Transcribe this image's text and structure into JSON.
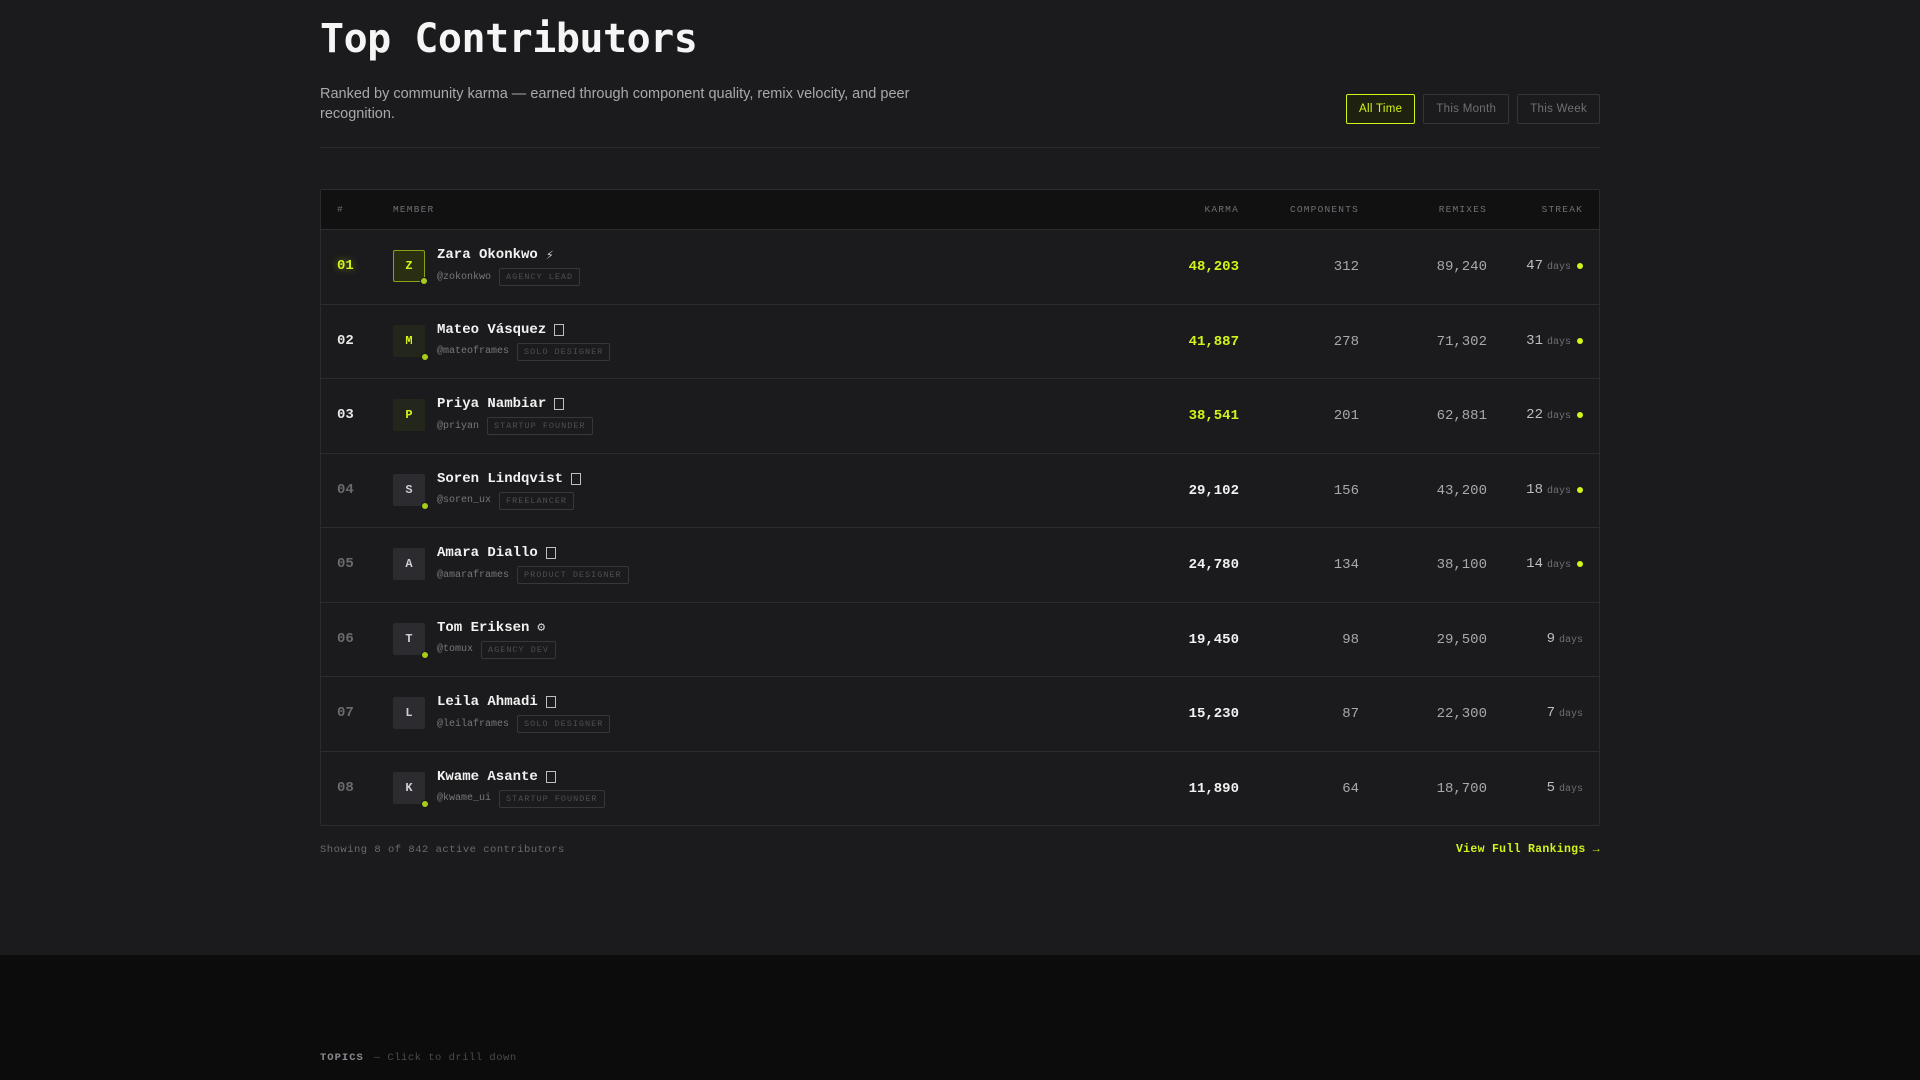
{
  "page": {
    "title": "Top Contributors",
    "subtitle": "Ranked by community karma — earned through component quality, remix velocity, and peer recognition."
  },
  "filters": [
    {
      "label": "All Time",
      "active": true
    },
    {
      "label": "This Month",
      "active": false
    },
    {
      "label": "This Week",
      "active": false
    }
  ],
  "table": {
    "headers": {
      "rank": "#",
      "member": "MEMBER",
      "karma": "KARMA",
      "components": "COMPONENTS",
      "remixes": "REMIXES",
      "streak": "STREAK"
    },
    "streak_unit": "days",
    "rows": [
      {
        "rank": "01",
        "initial": "Z",
        "name": "Zara Okonkwo",
        "badge": "⚡",
        "handle": "@zokonkwo",
        "role": "AGENCY LEAD",
        "karma": "48,203",
        "components": "312",
        "remixes": "89,240",
        "streak": "47",
        "online": true,
        "streak_active": true
      },
      {
        "rank": "02",
        "initial": "M",
        "name": "Mateo Vásquez",
        "badge": "box",
        "handle": "@mateoframes",
        "role": "SOLO DESIGNER",
        "karma": "41,887",
        "components": "278",
        "remixes": "71,302",
        "streak": "31",
        "online": true,
        "streak_active": true
      },
      {
        "rank": "03",
        "initial": "P",
        "name": "Priya Nambiar",
        "badge": "box",
        "handle": "@priyan",
        "role": "STARTUP FOUNDER",
        "karma": "38,541",
        "components": "201",
        "remixes": "62,881",
        "streak": "22",
        "online": false,
        "streak_active": true
      },
      {
        "rank": "04",
        "initial": "S",
        "name": "Soren Lindqvist",
        "badge": "box",
        "handle": "@soren_ux",
        "role": "FREELANCER",
        "karma": "29,102",
        "components": "156",
        "remixes": "43,200",
        "streak": "18",
        "online": true,
        "streak_active": true
      },
      {
        "rank": "05",
        "initial": "A",
        "name": "Amara Diallo",
        "badge": "box",
        "handle": "@amaraframes",
        "role": "PRODUCT DESIGNER",
        "karma": "24,780",
        "components": "134",
        "remixes": "38,100",
        "streak": "14",
        "online": false,
        "streak_active": true
      },
      {
        "rank": "06",
        "initial": "T",
        "name": "Tom Eriksen",
        "badge": "⚙",
        "handle": "@tomux",
        "role": "AGENCY DEV",
        "karma": "19,450",
        "components": "98",
        "remixes": "29,500",
        "streak": "9",
        "online": true,
        "streak_active": false
      },
      {
        "rank": "07",
        "initial": "L",
        "name": "Leila Ahmadi",
        "badge": "box",
        "handle": "@leilaframes",
        "role": "SOLO DESIGNER",
        "karma": "15,230",
        "components": "87",
        "remixes": "22,300",
        "streak": "7",
        "online": false,
        "streak_active": false
      },
      {
        "rank": "08",
        "initial": "K",
        "name": "Kwame Asante",
        "badge": "box",
        "handle": "@kwame_ui",
        "role": "STARTUP FOUNDER",
        "karma": "11,890",
        "components": "64",
        "remixes": "18,700",
        "streak": "5",
        "online": true,
        "streak_active": false
      }
    ]
  },
  "footer_bar": {
    "showing": "Showing 8 of 842 active contributors",
    "view_full": "View Full Rankings →"
  },
  "topics": {
    "label": "TOPICS",
    "hint": "— Click to drill down"
  },
  "colors": {
    "accent": "#d4f31a",
    "background": "#1b1b1d",
    "footer_bg": "#0c0c0d",
    "border": "#2c2c30"
  }
}
